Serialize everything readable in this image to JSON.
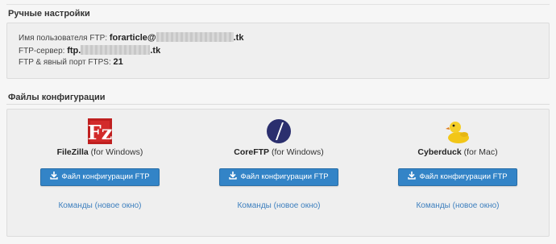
{
  "manual_settings": {
    "title": "Ручные настройки",
    "username_label": "Имя пользователя FTP:",
    "username_prefix": "forarticle@",
    "username_suffix": ".tk",
    "server_label": "FTP-сервер:",
    "server_prefix": "ftp.",
    "server_suffix": ".tk",
    "port_label": "FTP & явный порт FTPS:",
    "port_value": "21"
  },
  "config_files": {
    "title": "Файлы конфигурации",
    "clients": [
      {
        "icon": "filezilla-icon",
        "name": "FileZilla",
        "platform": "(for Windows)",
        "button_label": "Файл конфигурации FTP",
        "commands_link": "Команды (новое окно)"
      },
      {
        "icon": "coreftp-icon",
        "name": "CoreFTP",
        "platform": "(for Windows)",
        "button_label": "Файл конфигурации FTP",
        "commands_link": "Команды (новое окно)"
      },
      {
        "icon": "cyberduck-icon",
        "name": "Cyberduck",
        "platform": "(for Mac)",
        "button_label": "Файл конфигурации FTP",
        "commands_link": "Команды (новое окно)"
      }
    ]
  },
  "colors": {
    "button": "#3384c7",
    "link": "#3d7fbe",
    "filezilla": "#bf1f1f",
    "coreftp": "#2b2f6e",
    "cyberduck": "#f2c618"
  }
}
